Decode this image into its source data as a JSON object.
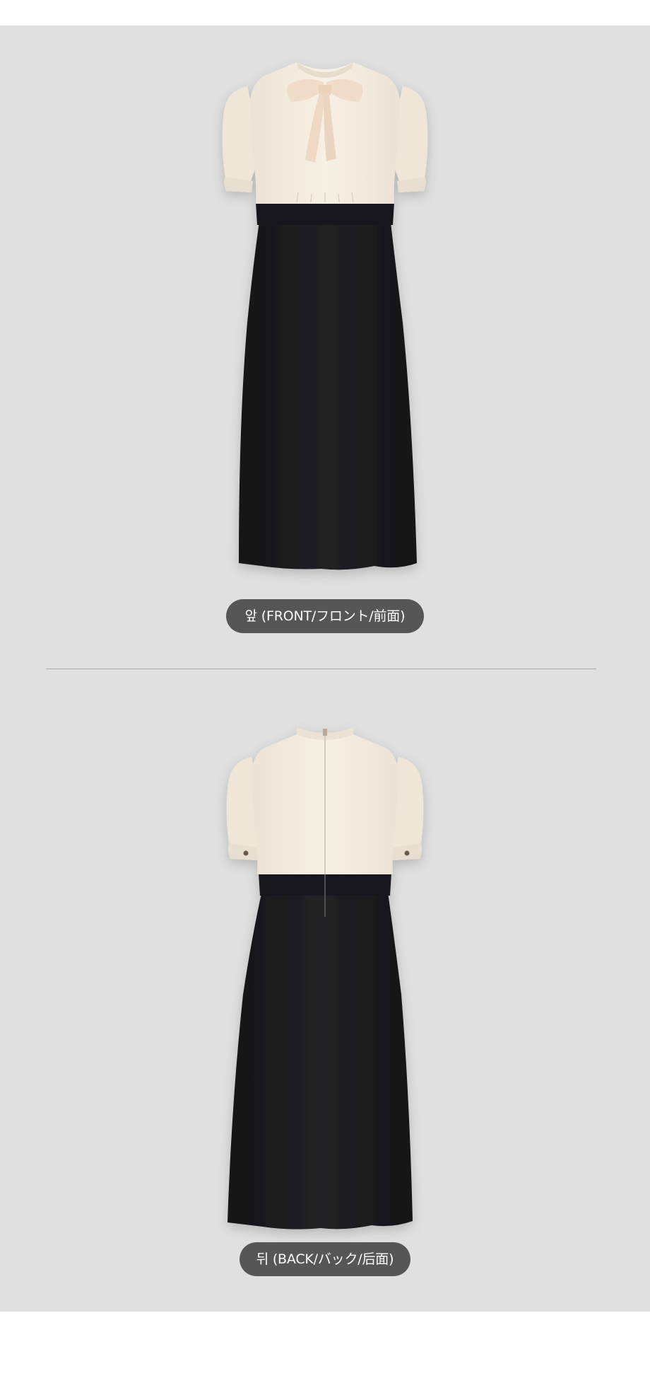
{
  "front": {
    "label": "앞 (FRONT/フロント/前面)"
  },
  "back": {
    "label": "뒤 (BACK/バック/后面)"
  },
  "colors": {
    "background": "#e0e0e0",
    "bodice": "#f4ecdf",
    "skirt": "#1b1b1d",
    "label_pill": "#565656",
    "label_text": "#ffffff"
  },
  "icons": {
    "front": "dress-front-image",
    "back": "dress-back-image"
  }
}
